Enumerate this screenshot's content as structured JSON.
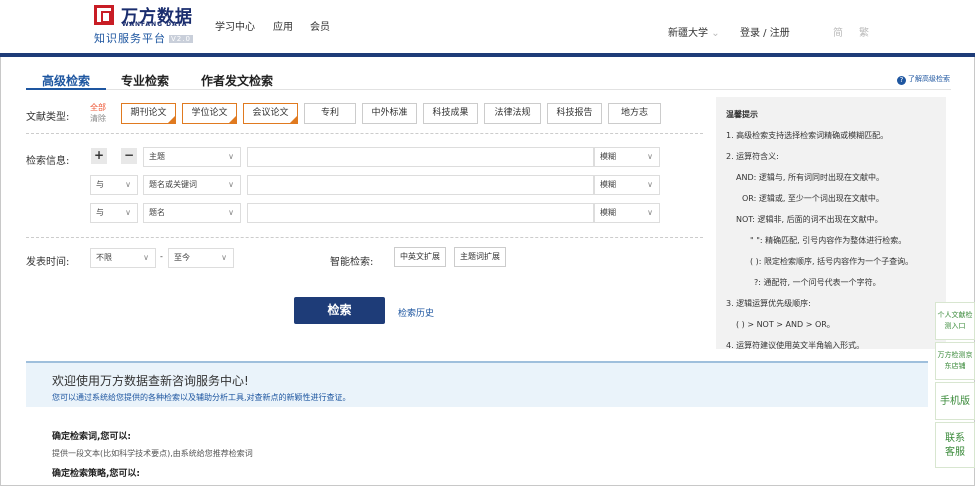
{
  "header": {
    "logo_cn": "万方数据",
    "logo_en": "WANFANG DATA",
    "subtitle": "知识服务平台",
    "version": "V2.0",
    "nav": [
      "学习中心",
      "应用",
      "会员"
    ],
    "institution": "新疆大学",
    "institution_arrow": "⌄",
    "login": "登录 / 注册",
    "lang_simplified": "简",
    "lang_traditional": "繁"
  },
  "tabs": [
    {
      "label": "高级检索"
    },
    {
      "label": "专业检索"
    },
    {
      "label": "作者发文检索"
    }
  ],
  "help_link": "了解高级检索",
  "form": {
    "doc_type_label": "文献类型:",
    "all": "全部",
    "clear": "清除",
    "doc_types": [
      {
        "label": "期刊论文"
      },
      {
        "label": "学位论文"
      },
      {
        "label": "会议论文"
      },
      {
        "label": "专利"
      },
      {
        "label": "中外标准"
      },
      {
        "label": "科技成果"
      },
      {
        "label": "法律法规"
      },
      {
        "label": "科技报告"
      },
      {
        "label": "地方志"
      }
    ],
    "search_info_label": "检索信息:",
    "plus": "+",
    "minus": "−",
    "rows": [
      {
        "op": "",
        "field": "主题",
        "match": "模糊"
      },
      {
        "op": "与",
        "field": "题名或关键词",
        "match": "模糊"
      },
      {
        "op": "与",
        "field": "题名",
        "match": "模糊"
      }
    ],
    "pub_time_label": "发表时间:",
    "time_from": "不限",
    "time_dash": "-",
    "time_to": "至今",
    "smart_label": "智能检索:",
    "smart_options": [
      "中英文扩展",
      "主题词扩展"
    ],
    "search_button": "检索",
    "history_link": "检索历史"
  },
  "tips": {
    "title": "温馨提示",
    "l1": "1. 高级检索支持选择检索词精确或模糊匹配。",
    "l2": "2. 运算符含义:",
    "and": "AND:  逻辑与, 所有词同时出现在文献中。",
    "or": "OR:  逻辑或, 至少一个词出现在文献中。",
    "not": "NOT:  逻辑非, 后面的词不出现在文献中。",
    "quote": "\" \":  精确匹配, 引号内容作为整体进行检索。",
    "paren": "( ):  限定检索顺序, 括号内容作为一个子查询。",
    "q": "?:  通配符, 一个问号代表一个字符。",
    "l3": "3. 逻辑运算优先级顺序:",
    "order": "( ) > NOT > AND > OR。",
    "l4": "4. 运算符建议使用英文半角输入形式。"
  },
  "welcome": {
    "title": "欢迎使用万方数据查新咨询服务中心!",
    "desc": "您可以通过系统给您提供的各种检索以及辅助分析工具,对查新点的新颖性进行查证。",
    "h1": "确定检索词,您可以:",
    "p1": "提供一段文本(比如科学技术要点),由系统给您推荐检索词",
    "h2": "确定检索策略,您可以:"
  },
  "side": {
    "s1": "个人文献检测入口",
    "s2": "万方检测京东店铺",
    "s3": "手机版",
    "s4": "联系客服"
  }
}
